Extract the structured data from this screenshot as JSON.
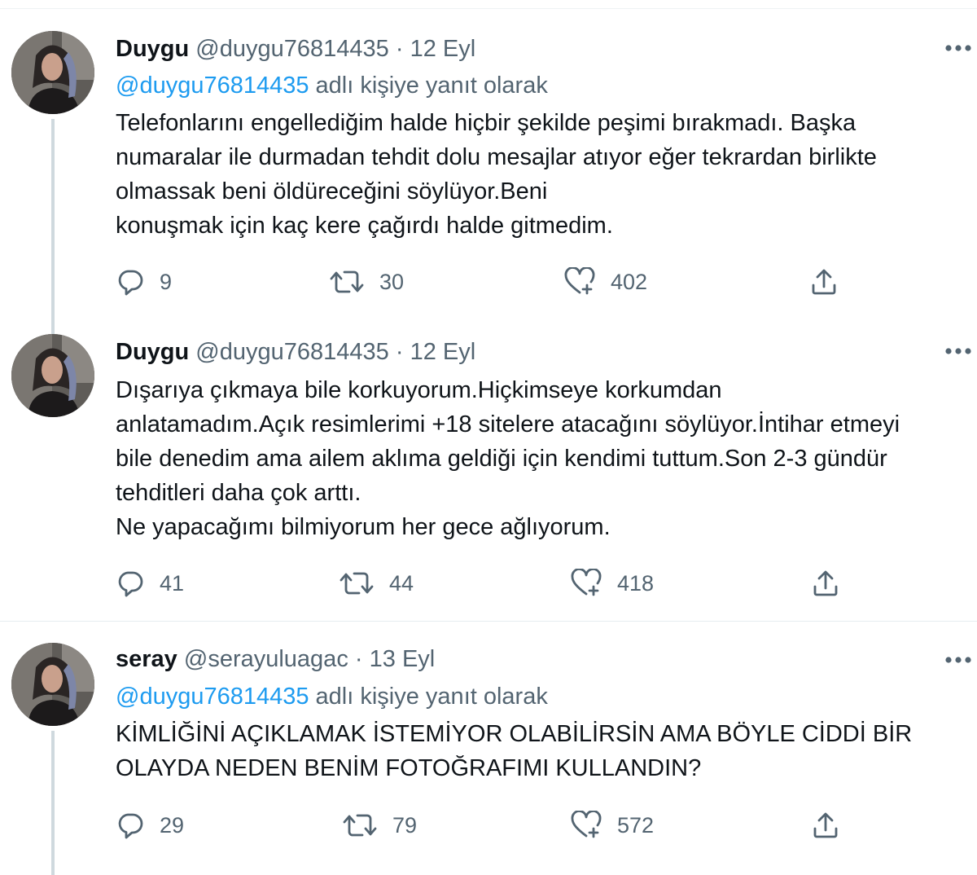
{
  "tweets": [
    {
      "name": "Duygu",
      "handle": "@duygu76814435",
      "separator": "·",
      "date": "12 Eyl",
      "replying_to": "@duygu76814435",
      "replying_suffix": "adlı kişiye yanıt olarak",
      "text": "Telefonlarını engellediğim halde hiçbir şekilde peşimi bırakmadı. Başka\nnumaralar ile durmadan tehdit dolu mesajlar atıyor eğer tekrardan birlikte\nolmassak beni öldüreceğini söylüyor.Beni\nkonuşmak için kaç kere çağırdı halde gitmedim.",
      "replies": "9",
      "retweets": "30",
      "likes": "402"
    },
    {
      "name": "Duygu",
      "handle": "@duygu76814435",
      "separator": "·",
      "date": "12 Eyl",
      "text": "Dışarıya çıkmaya bile korkuyorum.Hiçkimseye korkumdan\nanlatamadım.Açık resimlerimi +18 sitelere atacağını söylüyor.İntihar etmeyi\nbile denedim ama ailem aklıma geldiği için kendimi tuttum.Son 2-3 gündür\ntehditleri daha çok arttı.\nNe yapacağımı bilmiyorum her gece ağlıyorum.",
      "replies": "41",
      "retweets": "44",
      "likes": "418"
    },
    {
      "name": "seray",
      "handle": "@serayuluagac",
      "separator": "·",
      "date": "13 Eyl",
      "replying_to": "@duygu76814435",
      "replying_suffix": "adlı kişiye yanıt olarak",
      "text": "KİMLİĞİNİ AÇIKLAMAK İSTEMİYOR OLABİLİRSİN AMA BÖYLE CİDDİ BİR\nOLAYDA NEDEN BENİM FOTOĞRAFIMI KULLANDIN?",
      "replies": "29",
      "retweets": "79",
      "likes": "572"
    }
  ],
  "icons": {
    "avatar": "profile-photo",
    "more": "more-dots-icon",
    "reply": "reply-bubble-icon",
    "retweet": "retweet-icon",
    "like": "heart-icon",
    "share": "share-upload-icon"
  },
  "colors": {
    "text": "#0f1419",
    "secondary": "#536471",
    "link": "#1d9bf0",
    "thread_line": "#cfd9de",
    "divider": "#e6ecf0"
  }
}
